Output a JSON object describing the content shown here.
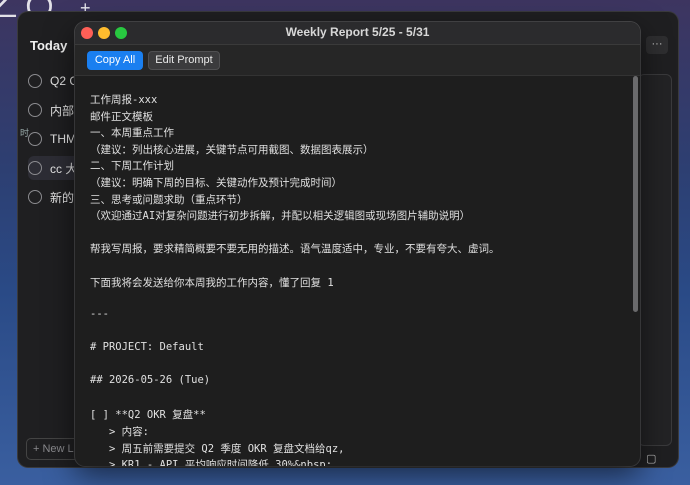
{
  "background": {
    "clock_fragment": "28",
    "plus_icon": "plus-icon",
    "today_label": "Today",
    "list_items": [
      "Q2 C",
      "内部工",
      "THM",
      "cc 大",
      "新的"
    ],
    "sidebar_text": [
      "时"
    ],
    "new_list_label": "+ New L",
    "more_label": "···",
    "download_label": "⬇",
    "calendar_icon": "▢"
  },
  "window": {
    "title": "Weekly Report  5/25 - 5/31",
    "copy_all_label": "Copy All",
    "edit_prompt_label": "Edit Prompt"
  },
  "content_lines": [
    "工作周报-xxx",
    "邮件正文模板",
    "一、本周重点工作",
    "（建议：列出核心进展，关键节点可用截图、数据图表展示）",
    "二、下周工作计划",
    "（建议：明确下周的目标、关键动作及预计完成时间）",
    "三、思考或问题求助（重点环节）",
    "（欢迎通过AI对复杂问题进行初步拆解，并配以相关逻辑图或现场图片辅助说明）",
    "",
    "帮我写周报，要求精简概要不要无用的描述。语气温度适中，专业，不要有夸大、虚词。",
    "",
    "下面我将会发送给你本周我的工作内容，懂了回复 1",
    "",
    "---",
    "",
    "# PROJECT: Default",
    "",
    "## 2026-05-26 (Tue)",
    "",
    "[ ] **Q2 OKR 复盘**",
    "   > 内容:",
    "   > 周五前需要提交 Q2 季度 OKR 复盘文档给qz,",
    "   > KR1 - API 平均响应时间降低 30%&nbsp;"
  ]
}
